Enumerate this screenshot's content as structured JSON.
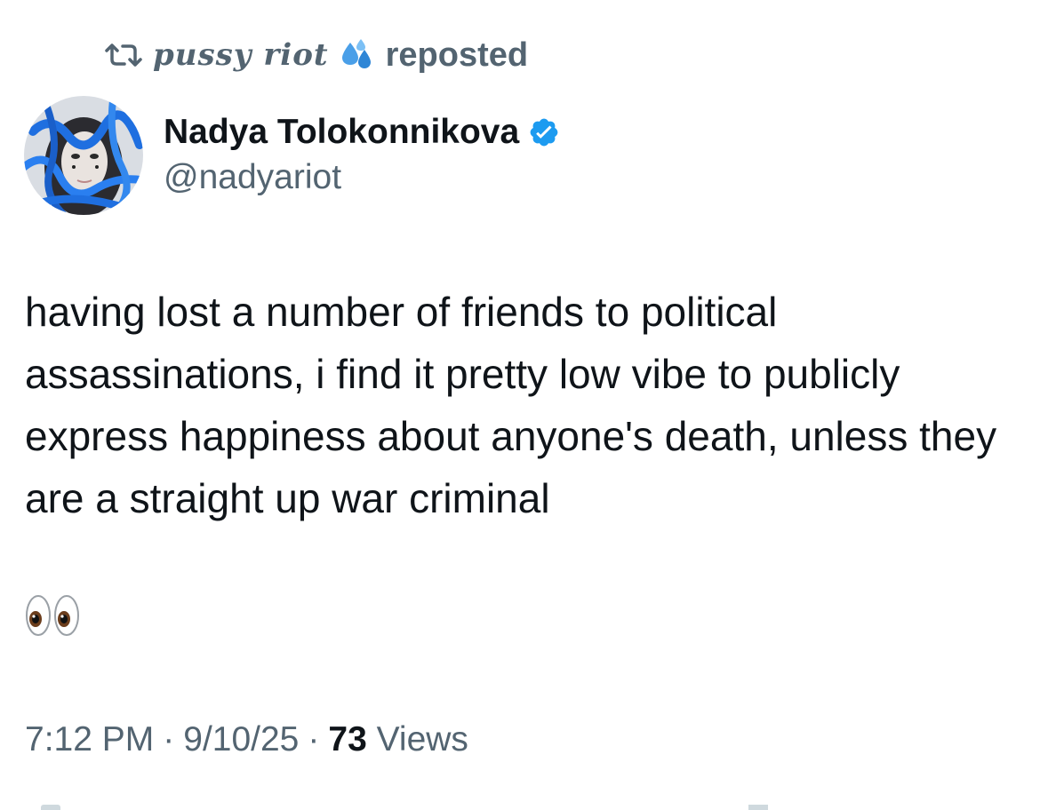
{
  "repost": {
    "icon": "repost-icon",
    "reposter_name": "pussy riot",
    "reposter_emoji": "droplets-icon",
    "label": "reposted"
  },
  "author": {
    "name": "Nadya Tolokonnikova",
    "handle": "@nadyariot",
    "verified": true,
    "verified_color": "#1d9bf0",
    "avatar": "avatar-photo"
  },
  "tweet": {
    "text": "having lost a number of friends to political assassinations, i find it pretty low vibe to publicly express happiness about anyone's death, unless they are a straight up war criminal",
    "emoji": "eyes-emoji"
  },
  "meta": {
    "time": "7:12 PM",
    "separator": "·",
    "date": "9/10/25",
    "views_count": "73",
    "views_label": "Views"
  },
  "colors": {
    "text_primary": "#0f1419",
    "text_secondary": "#536471",
    "accent": "#1d9bf0"
  }
}
